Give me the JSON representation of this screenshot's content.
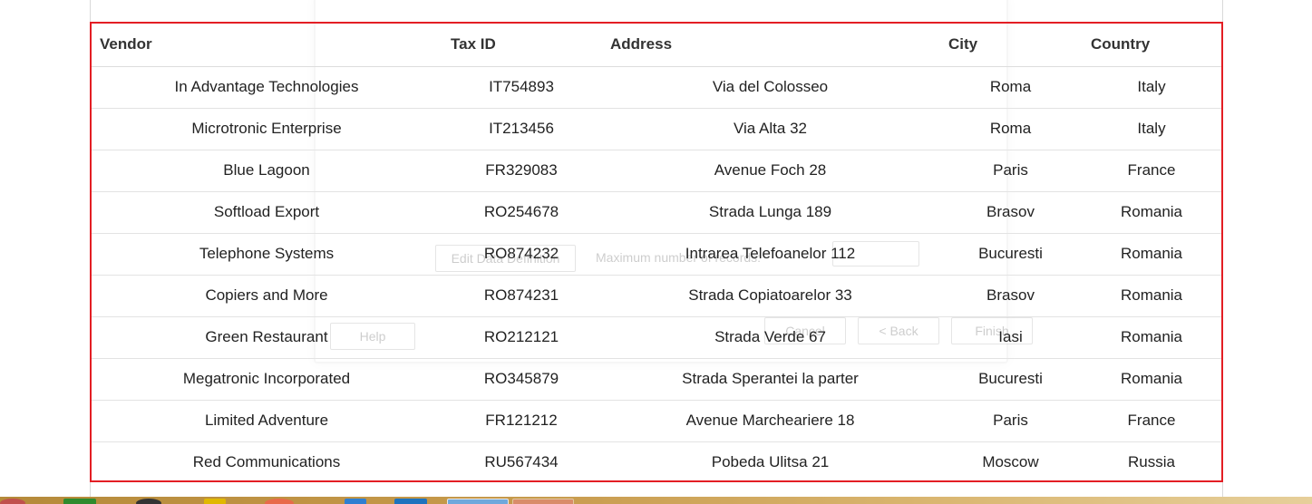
{
  "table": {
    "headers": [
      "Vendor",
      "Tax ID",
      "Address",
      "City",
      "Country"
    ],
    "rows": [
      [
        "In Advantage Technologies",
        "IT754893",
        "Via del Colosseo",
        "Roma",
        "Italy"
      ],
      [
        "Microtronic Enterprise",
        "IT213456",
        "Via Alta 32",
        "Roma",
        "Italy"
      ],
      [
        "Blue Lagoon",
        "FR329083",
        "Avenue Foch 28",
        "Paris",
        "France"
      ],
      [
        "Softload Export",
        "RO254678",
        "Strada Lunga 189",
        "Brasov",
        "Romania"
      ],
      [
        "Telephone Systems",
        "RO874232",
        "Intrarea Telefoanelor 112",
        "Bucuresti",
        "Romania"
      ],
      [
        "Copiers and More",
        "RO874231",
        "Strada Copiatoarelor 33",
        "Brasov",
        "Romania"
      ],
      [
        "Green Restaurant",
        "RO212121",
        "Strada Verde 67",
        "Iasi",
        "Romania"
      ],
      [
        "Megatronic Incorporated",
        "RO345879",
        "Strada Sperantei la parter",
        "Bucuresti",
        "Romania"
      ],
      [
        "Limited Adventure",
        "FR121212",
        "Avenue Marcheariere 18",
        "Paris",
        "France"
      ],
      [
        "Red Communications",
        "RU567434",
        "Pobeda Ulitsa 21",
        "Moscow",
        "Russia"
      ]
    ]
  },
  "background_dialog": {
    "edit_button": "Edit Data Definition",
    "max_label": "Maximum number of records:",
    "help_button": "Help",
    "cancel_button": "Cancel",
    "back_button": "< Back",
    "finish_button": "Finish"
  },
  "colors": {
    "frame_border": "#e31e24",
    "row_divider": "#e3e3e3"
  }
}
